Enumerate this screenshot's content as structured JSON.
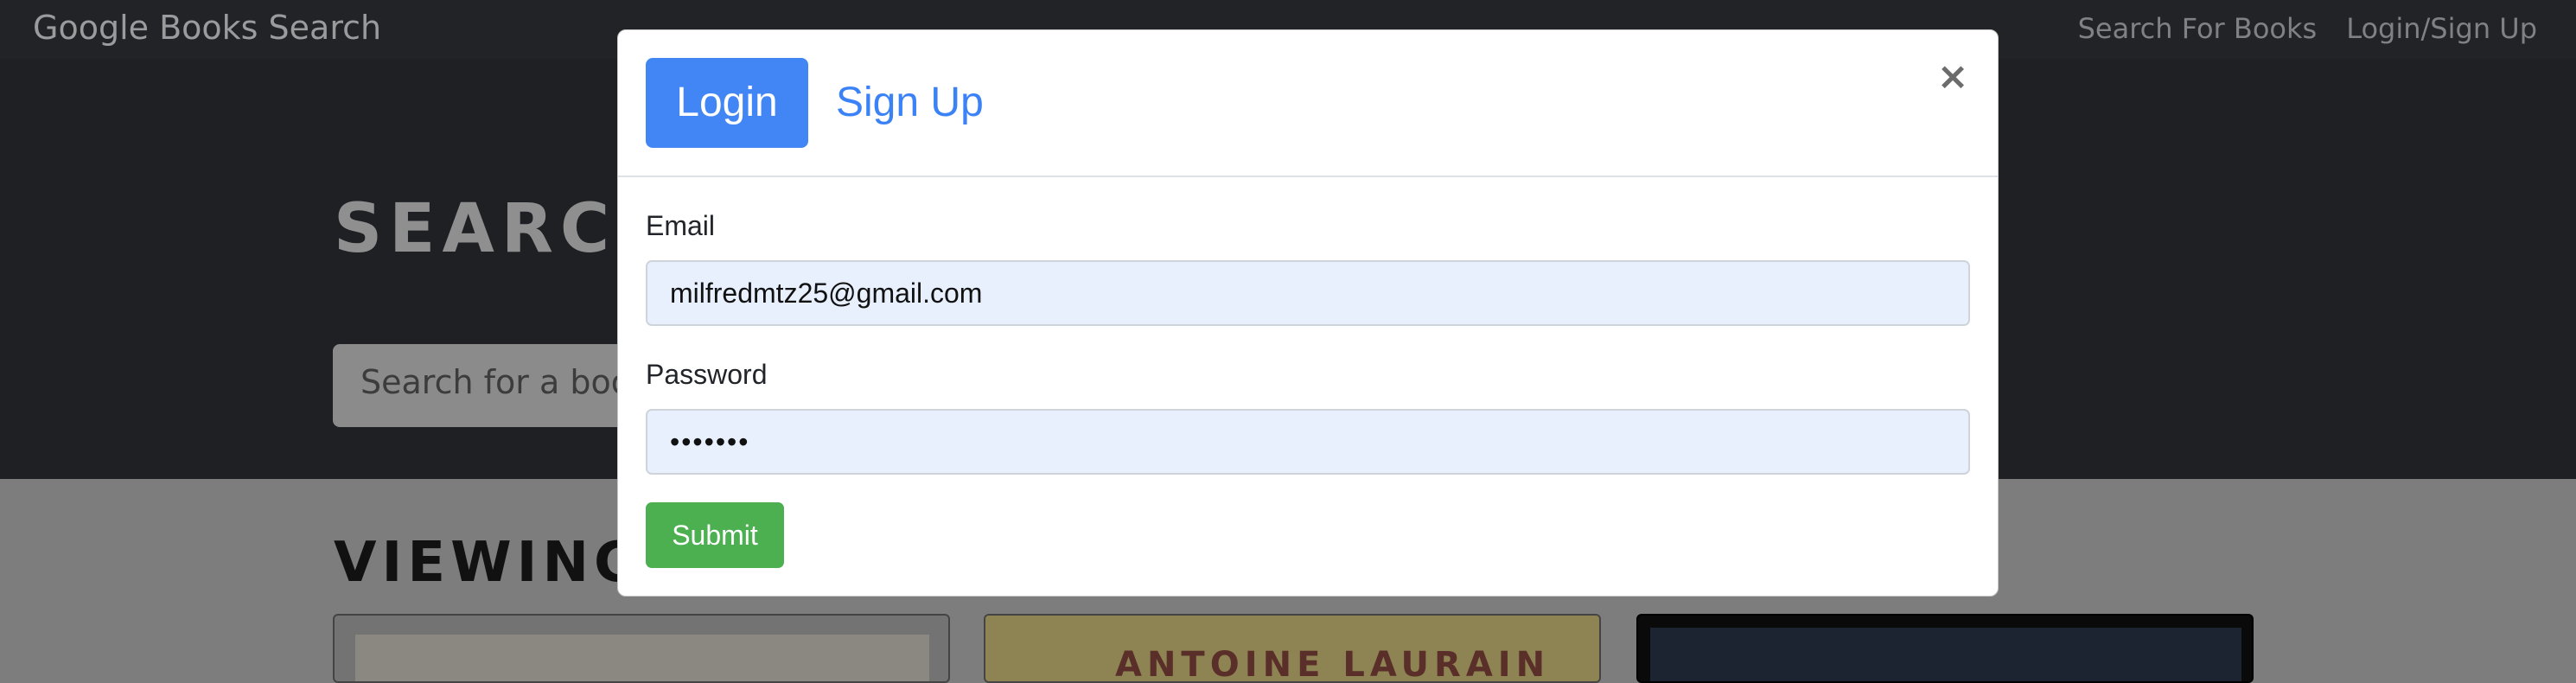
{
  "navbar": {
    "brand": "Google Books Search",
    "links": [
      "Search For Books",
      "Login/Sign Up"
    ]
  },
  "hero": {
    "title": "SEARCH FOR BOOKS!",
    "search_placeholder": "Search for a book"
  },
  "results": {
    "title": "VIEWING RESULTS:",
    "cards": [
      {
        "cover_text": ""
      },
      {
        "cover_text": "ANTOINE LAURAIN"
      },
      {
        "cover_text": ""
      }
    ]
  },
  "modal": {
    "tabs": {
      "login": "Login",
      "signup": "Sign Up"
    },
    "close": "×",
    "email_label": "Email",
    "email_value": "milfredmtz25@gmail.com",
    "password_label": "Password",
    "password_value": "•••••••",
    "submit_label": "Submit"
  },
  "colors": {
    "accent": "#4285f4",
    "submit": "#4caf50",
    "link": "#3b82f6",
    "navbar": "#212327"
  },
  "icons": {
    "close": "close-icon"
  }
}
